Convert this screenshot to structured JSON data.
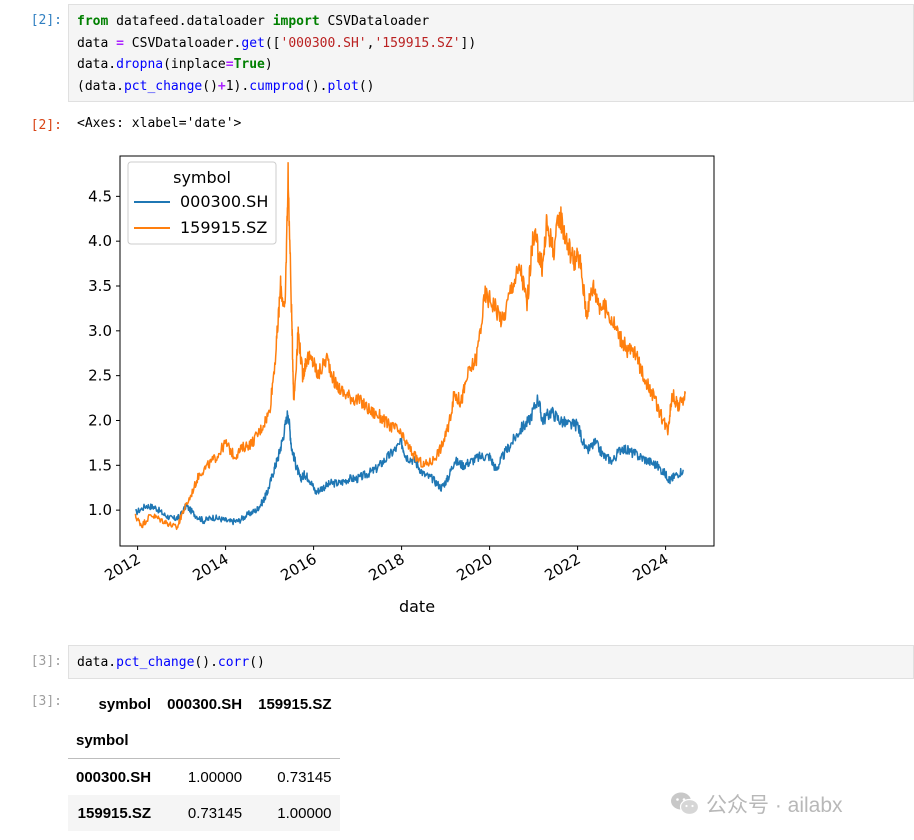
{
  "cells": [
    {
      "prompt": "[2]:",
      "code": [
        [
          [
            "kw",
            "from"
          ],
          [
            "plain",
            " datafeed.dataloader "
          ],
          [
            "kw",
            "import"
          ],
          [
            "plain",
            " CSVDataloader"
          ]
        ],
        [
          [
            "plain",
            "data "
          ],
          [
            "op",
            "="
          ],
          [
            "plain",
            " CSVDataloader."
          ],
          [
            "fn",
            "get"
          ],
          [
            "plain",
            "(["
          ],
          [
            "str",
            "'000300.SH'"
          ],
          [
            "plain",
            ","
          ],
          [
            "str",
            "'159915.SZ'"
          ],
          [
            "plain",
            "])"
          ]
        ],
        [
          [
            "plain",
            "data."
          ],
          [
            "fn",
            "dropna"
          ],
          [
            "plain",
            "(inplace"
          ],
          [
            "op",
            "="
          ],
          [
            "kw",
            "True"
          ],
          [
            "plain",
            ")"
          ]
        ],
        [
          [
            "plain",
            "(data."
          ],
          [
            "fn",
            "pct_change"
          ],
          [
            "plain",
            "()"
          ],
          [
            "op",
            "+"
          ],
          [
            "plain",
            "1)."
          ],
          [
            "fn",
            "cumprod"
          ],
          [
            "plain",
            "()."
          ],
          [
            "fn",
            "plot"
          ],
          [
            "plain",
            "()"
          ]
        ]
      ],
      "out_prompt": "[2]:",
      "out_text": "<Axes: xlabel='date'>"
    },
    {
      "prompt": "[3]:",
      "code": [
        [
          [
            "plain",
            "data."
          ],
          [
            "fn",
            "pct_change"
          ],
          [
            "plain",
            "()."
          ],
          [
            "fn",
            "corr"
          ],
          [
            "plain",
            "()"
          ]
        ]
      ],
      "out_prompt": "[3]:"
    }
  ],
  "chart_data": {
    "type": "line",
    "title": "",
    "xlabel": "date",
    "ylabel": "",
    "xlim": [
      2011.6,
      2025.1
    ],
    "ylim": [
      0.6,
      4.95
    ],
    "x_ticks": [
      "2012",
      "2014",
      "2016",
      "2018",
      "2020",
      "2022",
      "2024"
    ],
    "y_ticks": [
      "1.0",
      "1.5",
      "2.0",
      "2.5",
      "3.0",
      "3.5",
      "4.0",
      "4.5"
    ],
    "legend": {
      "title": "symbol",
      "placement": "top-left"
    },
    "grid": false,
    "series": [
      {
        "name": "000300.SH",
        "color": "#1f77b4",
        "x": [
          2011.95,
          2012.2,
          2012.4,
          2012.6,
          2012.8,
          2012.95,
          2013.1,
          2013.3,
          2013.5,
          2013.7,
          2013.9,
          2014.1,
          2014.3,
          2014.5,
          2014.7,
          2014.85,
          2014.95,
          2015.1,
          2015.2,
          2015.3,
          2015.42,
          2015.5,
          2015.6,
          2015.7,
          2015.8,
          2015.9,
          2016.05,
          2016.2,
          2016.4,
          2016.6,
          2016.8,
          2017.0,
          2017.2,
          2017.4,
          2017.6,
          2017.8,
          2018.0,
          2018.1,
          2018.3,
          2018.5,
          2018.7,
          2018.9,
          2019.05,
          2019.2,
          2019.4,
          2019.6,
          2019.8,
          2020.0,
          2020.15,
          2020.3,
          2020.5,
          2020.7,
          2020.9,
          2021.1,
          2021.2,
          2021.4,
          2021.6,
          2021.8,
          2022.0,
          2022.2,
          2022.4,
          2022.6,
          2022.8,
          2023.0,
          2023.2,
          2023.4,
          2023.6,
          2023.8,
          2024.0,
          2024.1,
          2024.2,
          2024.4
        ],
        "y": [
          0.97,
          1.05,
          1.03,
          0.95,
          0.9,
          0.92,
          1.05,
          0.95,
          0.88,
          0.92,
          0.9,
          0.87,
          0.88,
          0.95,
          1.0,
          1.1,
          1.2,
          1.45,
          1.6,
          1.8,
          2.1,
          1.7,
          1.5,
          1.35,
          1.4,
          1.35,
          1.2,
          1.25,
          1.3,
          1.3,
          1.35,
          1.35,
          1.4,
          1.45,
          1.55,
          1.65,
          1.75,
          1.6,
          1.55,
          1.4,
          1.35,
          1.25,
          1.35,
          1.55,
          1.5,
          1.55,
          1.6,
          1.6,
          1.45,
          1.6,
          1.75,
          1.9,
          2.0,
          2.25,
          2.0,
          2.1,
          2.0,
          1.95,
          1.95,
          1.65,
          1.75,
          1.6,
          1.55,
          1.7,
          1.65,
          1.6,
          1.55,
          1.5,
          1.4,
          1.33,
          1.38,
          1.45
        ]
      },
      {
        "name": "159915.SZ",
        "color": "#ff7f0e",
        "x": [
          2011.95,
          2012.1,
          2012.3,
          2012.5,
          2012.7,
          2012.9,
          2013.0,
          2013.2,
          2013.4,
          2013.6,
          2013.8,
          2014.0,
          2014.2,
          2014.4,
          2014.6,
          2014.8,
          2015.0,
          2015.15,
          2015.25,
          2015.35,
          2015.42,
          2015.5,
          2015.55,
          2015.65,
          2015.75,
          2015.85,
          2016.0,
          2016.1,
          2016.3,
          2016.5,
          2016.7,
          2016.9,
          2017.1,
          2017.3,
          2017.5,
          2017.7,
          2017.9,
          2018.1,
          2018.3,
          2018.5,
          2018.7,
          2018.9,
          2019.05,
          2019.2,
          2019.35,
          2019.5,
          2019.7,
          2019.9,
          2020.1,
          2020.3,
          2020.5,
          2020.7,
          2020.85,
          2021.0,
          2021.1,
          2021.2,
          2021.3,
          2021.45,
          2021.6,
          2021.75,
          2021.9,
          2022.05,
          2022.2,
          2022.35,
          2022.5,
          2022.7,
          2022.9,
          2023.1,
          2023.3,
          2023.5,
          2023.7,
          2023.9,
          2024.05,
          2024.15,
          2024.3,
          2024.45
        ],
        "y": [
          0.93,
          0.83,
          0.95,
          0.9,
          0.85,
          0.8,
          0.95,
          1.15,
          1.4,
          1.5,
          1.6,
          1.75,
          1.6,
          1.7,
          1.75,
          1.9,
          2.1,
          2.8,
          3.5,
          3.2,
          4.75,
          3.2,
          2.2,
          3.0,
          2.5,
          2.7,
          2.65,
          2.5,
          2.7,
          2.4,
          2.3,
          2.25,
          2.2,
          2.1,
          2.05,
          1.95,
          1.9,
          1.75,
          1.6,
          1.5,
          1.55,
          1.7,
          1.9,
          2.3,
          2.2,
          2.5,
          2.7,
          3.4,
          3.3,
          3.1,
          3.5,
          3.7,
          3.3,
          4.1,
          3.9,
          3.7,
          4.2,
          3.9,
          4.3,
          4.0,
          3.8,
          3.8,
          3.2,
          3.5,
          3.3,
          3.2,
          3.0,
          2.8,
          2.75,
          2.5,
          2.3,
          2.05,
          1.9,
          2.3,
          2.15,
          2.3
        ]
      }
    ]
  },
  "table": {
    "index_label": "symbol",
    "columns_label": "symbol",
    "columns": [
      "000300.SH",
      "159915.SZ"
    ],
    "rows": [
      {
        "index": "000300.SH",
        "values": [
          "1.00000",
          "0.73145"
        ]
      },
      {
        "index": "159915.SZ",
        "values": [
          "0.73145",
          "1.00000"
        ]
      }
    ]
  },
  "watermark": {
    "text": "公众号 · ailabx",
    "icon": "wechat-icon"
  }
}
